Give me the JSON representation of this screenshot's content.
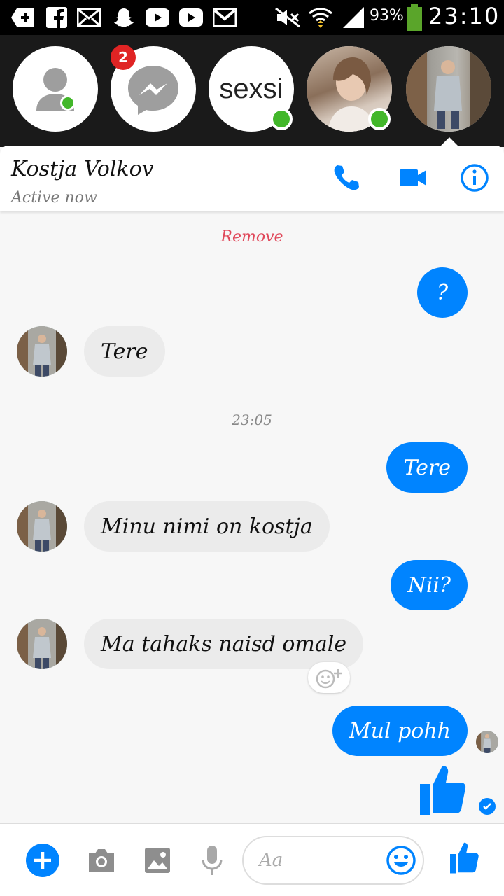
{
  "status_bar": {
    "battery": "93%",
    "time": "23:10"
  },
  "chat_heads": [
    {
      "name": "contacts",
      "online": true
    },
    {
      "name": "messenger",
      "badge": "2"
    },
    {
      "name": "sexsi",
      "label": "sexsi",
      "online": true
    },
    {
      "name": "girl-photo",
      "online": true
    },
    {
      "name": "kostja-photo",
      "active": true
    }
  ],
  "header": {
    "name": "Kostja Volkov",
    "status": "Active now"
  },
  "messages": {
    "remove_label": "Remove",
    "timestamp": "23:05",
    "items": [
      {
        "dir": "out",
        "text": "?"
      },
      {
        "dir": "in",
        "text": "Tere"
      },
      {
        "dir": "out",
        "text": "Tere"
      },
      {
        "dir": "in",
        "text": "Minu nimi on kostja"
      },
      {
        "dir": "out",
        "text": "Nii?"
      },
      {
        "dir": "in",
        "text": "Ma tahaks naisd omale"
      },
      {
        "dir": "out",
        "text": "Mul pohh"
      }
    ]
  },
  "composer": {
    "placeholder": "Aa"
  },
  "colors": {
    "accent": "#0084ff",
    "online": "#42b72a",
    "badge": "#e02424",
    "remove": "#e0485a"
  }
}
